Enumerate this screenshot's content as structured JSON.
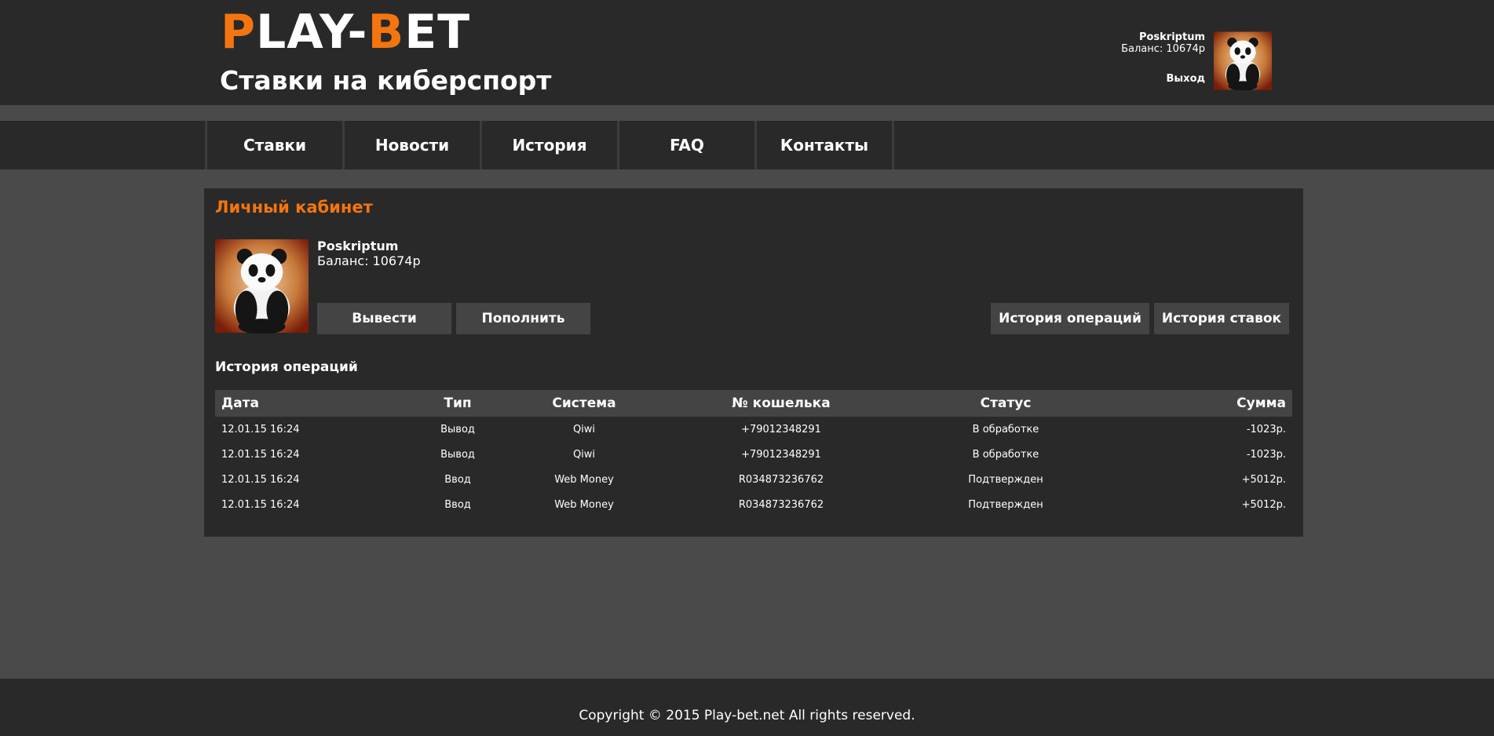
{
  "header": {
    "logo_part1": "P",
    "logo_part2": "LAY-",
    "logo_part3": "B",
    "logo_part4": "ET",
    "tagline": "Ставки на киберспорт",
    "username": "Poskriptum",
    "balance": "Баланс: 10674р",
    "logout": "Выход"
  },
  "nav": {
    "items": [
      {
        "label": "Ставки"
      },
      {
        "label": "Новости"
      },
      {
        "label": "История"
      },
      {
        "label": "FAQ"
      },
      {
        "label": "Контакты"
      }
    ]
  },
  "account": {
    "title": "Личный кабинет",
    "username": "Poskriptum",
    "balance": "Баланс: 10674р",
    "withdraw_button": "Вывести",
    "deposit_button": "Пополнить",
    "operations_history_button": "История операций",
    "bets_history_button": "История ставок",
    "section_title": "История операций"
  },
  "table": {
    "headers": [
      "Дата",
      "Тип",
      "Система",
      "№ кошелька",
      "Статус",
      "Сумма"
    ],
    "rows": [
      [
        "12.01.15 16:24",
        "Вывод",
        "Qiwi",
        "+79012348291",
        "В обработке",
        "-1023р."
      ],
      [
        "12.01.15 16:24",
        "Вывод",
        "Qiwi",
        "+79012348291",
        "В обработке",
        "-1023р."
      ],
      [
        "12.01.15 16:24",
        "Ввод",
        "Web Money",
        "R034873236762",
        "Подтвержден",
        "+5012р."
      ],
      [
        "12.01.15 16:24",
        "Ввод",
        "Web Money",
        "R034873236762",
        "Подтвержден",
        "+5012р."
      ]
    ]
  },
  "footer": {
    "copyright": "Copyright © 2015 Play-bet.net All rights reserved."
  },
  "colors": {
    "accent": "#f4750f",
    "background": "#4a4a4a",
    "panel": "#292929",
    "button": "#444444"
  }
}
